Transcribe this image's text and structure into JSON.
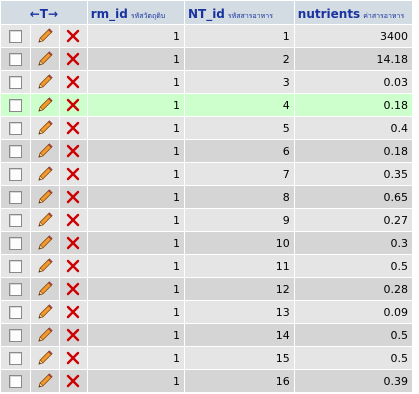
{
  "colors": {
    "header_bg": "#d3dce3",
    "header_text": "#1a33a0",
    "row_odd": "#e5e5e5",
    "row_even": "#d5d5d5",
    "row_highlight": "#ccffcc",
    "delete_icon": "#cc0000",
    "edit_icon": "#e07a10"
  },
  "header": {
    "arrows": "←T→",
    "columns": [
      {
        "name": "rm_id",
        "subtitle": "รหัสวัตถุดิบ"
      },
      {
        "name": "NT_id",
        "subtitle": "รหัสสารอาหาร"
      },
      {
        "name": "nutrients",
        "subtitle": "ค่าสารอาหาร"
      }
    ]
  },
  "rows": [
    {
      "rm_id": "1",
      "nt_id": "1",
      "nutrients": "3400"
    },
    {
      "rm_id": "1",
      "nt_id": "2",
      "nutrients": "14.18"
    },
    {
      "rm_id": "1",
      "nt_id": "3",
      "nutrients": "0.03"
    },
    {
      "rm_id": "1",
      "nt_id": "4",
      "nutrients": "0.18",
      "highlighted": true
    },
    {
      "rm_id": "1",
      "nt_id": "5",
      "nutrients": "0.4"
    },
    {
      "rm_id": "1",
      "nt_id": "6",
      "nutrients": "0.18"
    },
    {
      "rm_id": "1",
      "nt_id": "7",
      "nutrients": "0.35"
    },
    {
      "rm_id": "1",
      "nt_id": "8",
      "nutrients": "0.65"
    },
    {
      "rm_id": "1",
      "nt_id": "9",
      "nutrients": "0.27"
    },
    {
      "rm_id": "1",
      "nt_id": "10",
      "nutrients": "0.3"
    },
    {
      "rm_id": "1",
      "nt_id": "11",
      "nutrients": "0.5"
    },
    {
      "rm_id": "1",
      "nt_id": "12",
      "nutrients": "0.28"
    },
    {
      "rm_id": "1",
      "nt_id": "13",
      "nutrients": "0.09"
    },
    {
      "rm_id": "1",
      "nt_id": "14",
      "nutrients": "0.5"
    },
    {
      "rm_id": "1",
      "nt_id": "15",
      "nutrients": "0.5"
    },
    {
      "rm_id": "1",
      "nt_id": "16",
      "nutrients": "0.39"
    }
  ]
}
